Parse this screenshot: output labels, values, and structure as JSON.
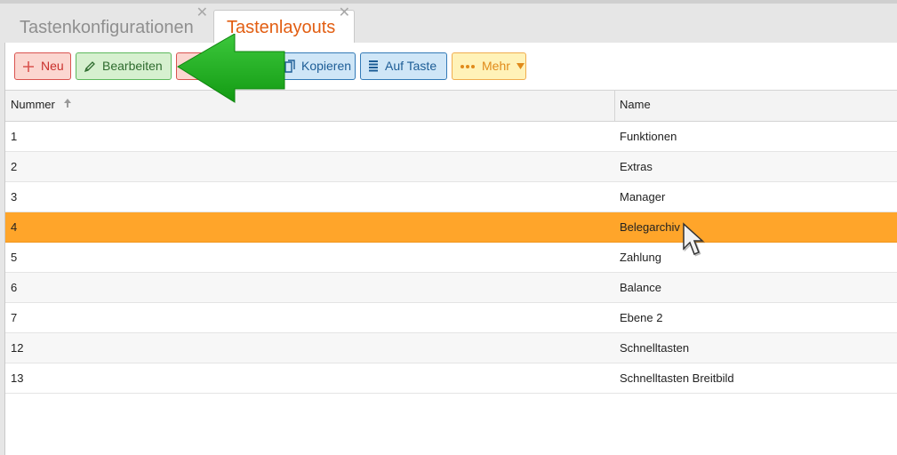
{
  "tabs": [
    {
      "label": "Tastenkonfigurationen",
      "active": false
    },
    {
      "label": "Tastenlayouts",
      "active": true
    }
  ],
  "toolbar": {
    "new_label": "Neu",
    "edit_label": "Bearbeiten",
    "copy_label": "Kopieren",
    "key_label": "Auf Taste",
    "more_label": "Mehr"
  },
  "table": {
    "columns": [
      "Nummer",
      "Name"
    ],
    "rows": [
      {
        "number": "1",
        "name": "Funktionen"
      },
      {
        "number": "2",
        "name": "Extras"
      },
      {
        "number": "3",
        "name": "Manager"
      },
      {
        "number": "4",
        "name": "Belegarchiv",
        "selected": true
      },
      {
        "number": "5",
        "name": "Zahlung"
      },
      {
        "number": "6",
        "name": "Balance"
      },
      {
        "number": "7",
        "name": "Ebene 2"
      },
      {
        "number": "12",
        "name": "Schnelltasten"
      },
      {
        "number": "13",
        "name": "Schnelltasten Breitbild"
      }
    ]
  },
  "colors": {
    "selected_row": "#ffa52a",
    "active_tab_text": "#e25e12",
    "arrow": "#1aa81a"
  },
  "icons": {
    "new": "plus-icon",
    "edit": "pencil-icon",
    "copy": "copy-icon",
    "key": "list-icon",
    "more": "dots-icon",
    "sort": "sort-up-icon",
    "close": "close-icon"
  }
}
